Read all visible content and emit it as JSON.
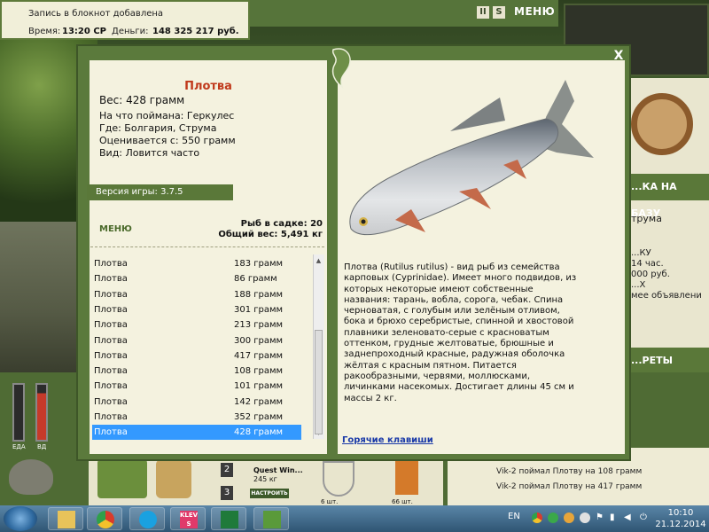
{
  "topbar": {
    "message": "Запись в блокнот добавлена",
    "time_label": "Время:",
    "time_value": "13:20 СР",
    "money_label": "Деньги:",
    "money_value": "148 325 217 руб.",
    "nav_menu": "МЕНЮ",
    "nav_pause": "II",
    "nav_sound": "S"
  },
  "fish": {
    "name": "Плотва",
    "weight": "Вес: 428 грамм",
    "bait": "На что поймана: Геркулес",
    "location": "Где: Болгария, Струма",
    "valued": "Оценивается с: 550 грамм",
    "frequency": "Вид: Ловится часто",
    "description": "Плотва (Rutilus rutilus) - вид рыб из семейства карповых (Cyprinidae). Имеет много подвидов, из которых некоторые имеют собственные названия: тарань, вобла, сорога, чебак. Спина черноватая, с голубым или зелёным отливом, бока и брюхо серебристые, спинной и хвостовой плавники зеленовато-серые с красноватым оттенком, грудные желтоватые, брюшные и заднепроходный красные, радужная оболочка жёлтая с красным пятном. Питается ракообразными, червями, моллюсками, личинками насекомых. Достигает длины 45 см и массы 2 кг."
  },
  "version": "Версия игры: 3.7.5",
  "menu_label": "МЕНЮ",
  "keepnet": {
    "count": "Рыб в садке: 20",
    "total_weight": "Общий вес: 5,491 кг"
  },
  "catch_list": [
    {
      "name": "Плотва",
      "weight": "183 грамм"
    },
    {
      "name": "Плотва",
      "weight": "86 грамм"
    },
    {
      "name": "Плотва",
      "weight": "188 грамм"
    },
    {
      "name": "Плотва",
      "weight": "301 грамм"
    },
    {
      "name": "Плотва",
      "weight": "213 грамм"
    },
    {
      "name": "Плотва",
      "weight": "300 грамм"
    },
    {
      "name": "Плотва",
      "weight": "417 грамм"
    },
    {
      "name": "Плотва",
      "weight": "108 грамм"
    },
    {
      "name": "Плотва",
      "weight": "101 грамм"
    },
    {
      "name": "Плотва",
      "weight": "142 грамм"
    },
    {
      "name": "Плотва",
      "weight": "352 грамм"
    },
    {
      "name": "Плотва",
      "weight": "428 грамм"
    }
  ],
  "selected_index": 11,
  "hotkeys": "Горячие клавиши",
  "close_label": "X",
  "background": {
    "base_banner": "...КА НА БАЗУ",
    "location_short": "трума",
    "r1": "...КУ",
    "r2": "14 час.",
    "r3": "000 руб.",
    "r4": "...Х",
    "r5": "мее объявлени",
    "secrets_banner": "...РЕТЫ",
    "quest": "Quest Win...",
    "quest_weight": "245 кг",
    "setup": "НАСТРОИТЬ",
    "slot2": "2",
    "slot3": "3",
    "items_count1": "6 шт.",
    "items_count2": "66 шт.",
    "food_label": "ЕДА",
    "water_label": "ВД",
    "chat": [
      "Vik-2 поймал Плотву на 108 грамм",
      "Vik-2 поймал Плотву на 417 грамм"
    ]
  },
  "taskbar": {
    "lang": "EN",
    "time": "10:10",
    "date": "21.12.2014",
    "klev_label": "KLEV S"
  },
  "colors": {
    "accent_green": "#5a7839",
    "fish_name_red": "#c0391b",
    "selection_blue": "#3399ff",
    "panel_cream": "#f4f2df"
  }
}
